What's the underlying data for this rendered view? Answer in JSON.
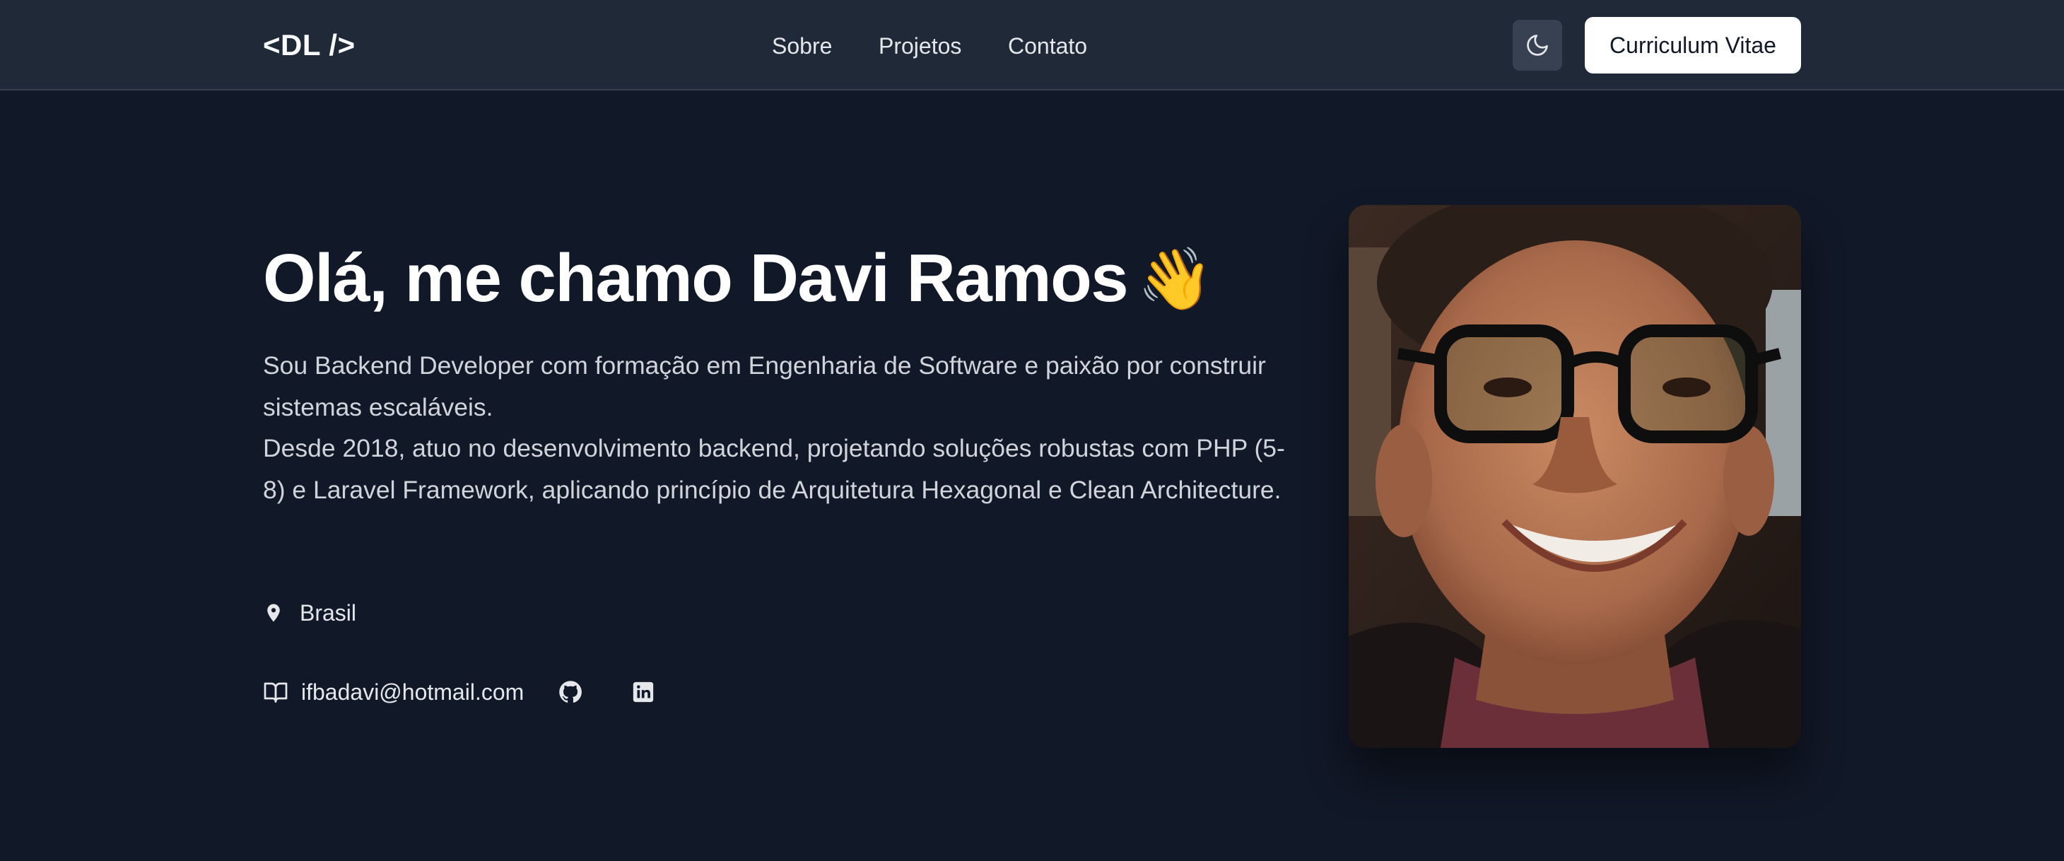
{
  "header": {
    "logo": "<DL />",
    "nav": [
      {
        "label": "Sobre"
      },
      {
        "label": "Projetos"
      },
      {
        "label": "Contato"
      }
    ],
    "theme_toggle_icon": "moon-icon",
    "cv_button": "Curriculum Vitae"
  },
  "hero": {
    "title": "Olá, me chamo Davi Ramos",
    "emoji": "👋",
    "bio": [
      "Sou Backend Developer com formação em Engenharia de Software e paixão por construir sistemas escaláveis.",
      "Desde 2018, atuo no desenvolvimento backend, projetando soluções robustas com PHP (5-8) e Laravel Framework, aplicando princípio de Arquitetura Hexagonal e Clean Architecture."
    ],
    "location": {
      "icon": "map-pin-icon",
      "label": "Brasil"
    },
    "email": {
      "icon": "book-open-icon",
      "label": "ifbadavi@hotmail.com"
    },
    "social": [
      {
        "icon": "github-icon"
      },
      {
        "icon": "linkedin-icon"
      }
    ]
  },
  "colors": {
    "background": "#111827",
    "header_background": "#1f2937",
    "text": "#f3f4f6",
    "muted_text": "#d1d5db",
    "button_background": "#ffffff"
  }
}
